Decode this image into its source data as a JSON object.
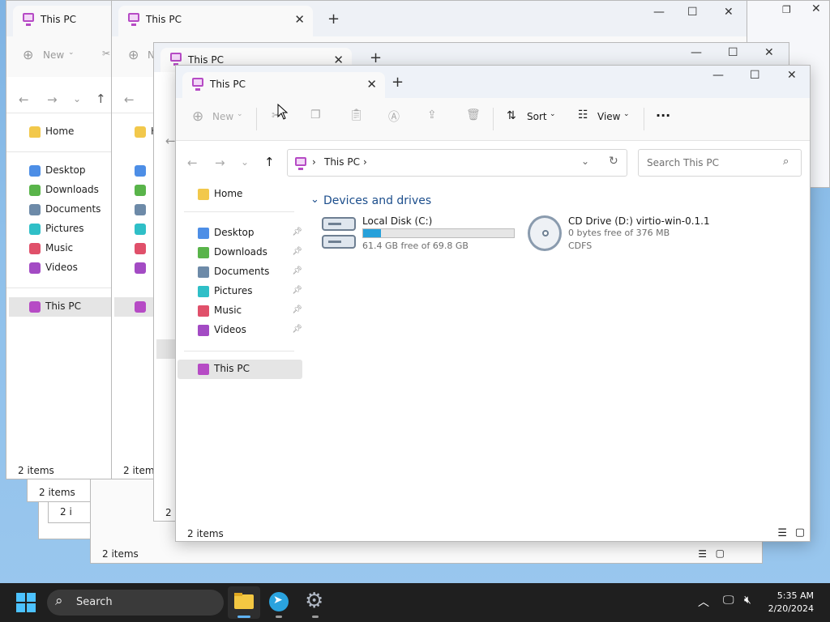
{
  "background_windows": [
    {
      "tab_title": "This PC",
      "status": "2 items",
      "new_label": "New",
      "nav": [
        "Home",
        "Desktop",
        "Downloads",
        "Documents",
        "Pictures",
        "Music",
        "Videos",
        "This PC"
      ]
    },
    {
      "tab_title": "This PC",
      "status": "2 items"
    },
    {
      "tab_title": "This PC"
    },
    {
      "status": "2 items"
    },
    {
      "status": "2 items"
    },
    {
      "status": "2 i"
    },
    {
      "status": "2 i"
    },
    {
      "status": "2 i"
    }
  ],
  "window": {
    "tab_title": "This PC",
    "toolbar": {
      "new_label": "New",
      "sort_label": "Sort",
      "view_label": "View",
      "more_label": "···"
    },
    "address": {
      "crumb": "This PC"
    },
    "search": {
      "placeholder": "Search This PC"
    },
    "nav": {
      "home": "Home",
      "desktop": "Desktop",
      "downloads": "Downloads",
      "documents": "Documents",
      "pictures": "Pictures",
      "music": "Music",
      "videos": "Videos",
      "thispc": "This PC"
    },
    "section_title": "Devices and drives",
    "drives": [
      {
        "name": "Local Disk (C:)",
        "free_text": "61.4 GB free of 69.8 GB",
        "used_fraction": 0.12
      },
      {
        "name": "CD Drive (D:) virtio-win-0.1.1",
        "free_text": "0 bytes free of 376 MB",
        "fs": "CDFS"
      }
    ],
    "status": "2 items"
  },
  "taskbar": {
    "search_label": "Search",
    "time": "5:35 AM",
    "date": "2/20/2024"
  },
  "colors": {
    "accent": "#26a0da",
    "section_title": "#1c4e8c",
    "this_pc_icon": "#b64bc5"
  }
}
